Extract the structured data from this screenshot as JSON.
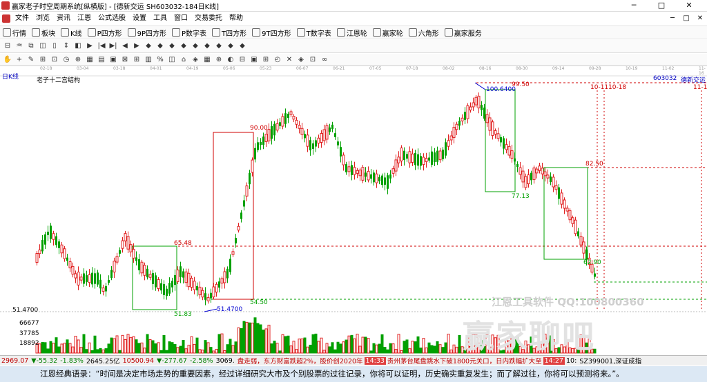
{
  "window": {
    "title": "赢家老子时空周期系统[纵横版] - [德新交运  SH603032-184日K线]",
    "min": "─",
    "max": "□",
    "close": "✕"
  },
  "menu": {
    "items": [
      "文件",
      "浏览",
      "资讯",
      "江恩",
      "公式选股",
      "设置",
      "工具",
      "窗口",
      "交易委托",
      "帮助"
    ],
    "right": [
      "─",
      "□",
      "✕"
    ]
  },
  "toolbar1": {
    "items": [
      {
        "icon": "grid-icon",
        "label": "行情"
      },
      {
        "icon": "blocks-icon",
        "label": "板块"
      },
      {
        "icon": "kline-icon",
        "label": "K线"
      },
      {
        "icon": "p-box-icon",
        "label": "P四方形"
      },
      {
        "icon": "9p-box-icon",
        "label": "9P四方形"
      },
      {
        "icon": "p-table-icon",
        "label": "P数字表"
      },
      {
        "icon": "t-box-icon",
        "label": "T四方形"
      },
      {
        "icon": "9t-box-icon",
        "label": "9T四方形"
      },
      {
        "icon": "t-table-icon",
        "label": "T数字表"
      },
      {
        "icon": "gann-wheel-icon",
        "label": "江恩轮"
      },
      {
        "icon": "winner-wheel-icon",
        "label": "赢家轮"
      },
      {
        "icon": "hexagon-icon",
        "label": "六角形"
      },
      {
        "icon": "dollar-icon",
        "label": "赢家服务"
      }
    ]
  },
  "toolbar2": {
    "icons": [
      "⊟",
      "♒",
      "⧉",
      "◫",
      "▯",
      "⇕",
      "◧",
      "▶",
      "|◀",
      "▶|",
      "◀",
      "▶",
      "◆",
      "◆",
      "◆",
      "◆",
      "◆",
      "◆",
      "◆",
      "◆",
      "◆"
    ]
  },
  "toolbar3": {
    "icons": [
      "✋",
      "+",
      "✎",
      "⊞",
      "⊡",
      "◷",
      "⊕",
      "▦",
      "▤",
      "▣",
      "⊠",
      "⊞",
      "▥",
      "%",
      "◫",
      "⌂",
      "◈",
      "▦",
      "⊕",
      "◐",
      "⊟",
      "▣",
      "⊞",
      "◴",
      "✕",
      "◈",
      "⊡",
      "∞"
    ]
  },
  "chart": {
    "period_label": "日K线",
    "title": "老子十二宫结构",
    "code": "603032",
    "name": "德新交运",
    "dates": [
      "02-18",
      "03-04",
      "03-18",
      "04-01",
      "04-19",
      "05-06",
      "05-23",
      "06-07",
      "06-21",
      "07-05",
      "07-18",
      "08-02",
      "08-16",
      "08-30",
      "09-14",
      "09-28",
      "10-19",
      "11-02",
      "11-16"
    ],
    "annotations": [
      {
        "text": "90.00",
        "color": "#d00000"
      },
      {
        "text": "65.48",
        "color": "#d00000"
      },
      {
        "text": "54.50",
        "color": "#00a000"
      },
      {
        "text": "51.83",
        "color": "#00a000"
      },
      {
        "text": "51.4700",
        "color": "#0000d0"
      },
      {
        "text": "100.6400",
        "color": "#0000d0"
      },
      {
        "text": "99.50",
        "color": "#d00000"
      },
      {
        "text": "77.13",
        "color": "#00a000"
      },
      {
        "text": "82.50",
        "color": "#d00000"
      },
      {
        "text": "62.90",
        "color": "#00a000"
      },
      {
        "text": "10-11",
        "color": "#d00000"
      },
      {
        "text": "10-18",
        "color": "#d00000"
      },
      {
        "text": "11-1",
        "color": "#d00000"
      }
    ],
    "left_price": "51.4700",
    "volume_ticks": [
      "66677",
      "37785",
      "18892"
    ]
  },
  "chart_data": {
    "type": "candlestick",
    "title": "老子十二宫结构",
    "symbol": "603032",
    "levels": {
      "high_marker": 100.64,
      "low_marker": 51.47,
      "box1_top": 65.48,
      "box1_bottom": 51.83,
      "box2_top": 90.0,
      "box2_bottom": 54.5,
      "box3_top": 99.5,
      "box3_bottom": 77.13,
      "box4_top": 82.5,
      "box4_bottom": 62.9
    }
  },
  "watermark": {
    "line1": "江恩工具软件  QQ:100800360",
    "line2": "赢家聊吧"
  },
  "status": {
    "items": [
      {
        "text": "2969.07",
        "color": "#c00000"
      },
      {
        "text": "▼-55.32",
        "color": "#008000"
      },
      {
        "text": "-1.83%",
        "color": "#008000"
      },
      {
        "text": "2645.25亿",
        "color": "#000"
      },
      {
        "text": "10500.94",
        "color": "#c00000"
      },
      {
        "text": "▼-277.67",
        "color": "#008000"
      },
      {
        "text": "-2.58%",
        "color": "#008000"
      },
      {
        "text": "3069.",
        "color": "#000"
      },
      {
        "text": "盘走弱，东方财富跌超2%，股价创2020年",
        "color": "#c00000"
      },
      {
        "text": "14:33",
        "color": "#fff"
      },
      {
        "text": "贵州茅台尾盘跳水下破1800元关口，日内跌幅扩大至",
        "color": "#c00000"
      },
      {
        "text": "14:27",
        "color": "#fff"
      },
      {
        "text": "10:",
        "color": "#000"
      },
      {
        "text": "SZ399001,深证成指",
        "color": "#000"
      }
    ]
  },
  "quote": "江恩经典语录：“时间是决定市场走势的重要因素，经过详细研究大市及个别股票的过往记录，你将可以证明，历史确实重复发生；而了解过往，你将可以预测将来。”。"
}
